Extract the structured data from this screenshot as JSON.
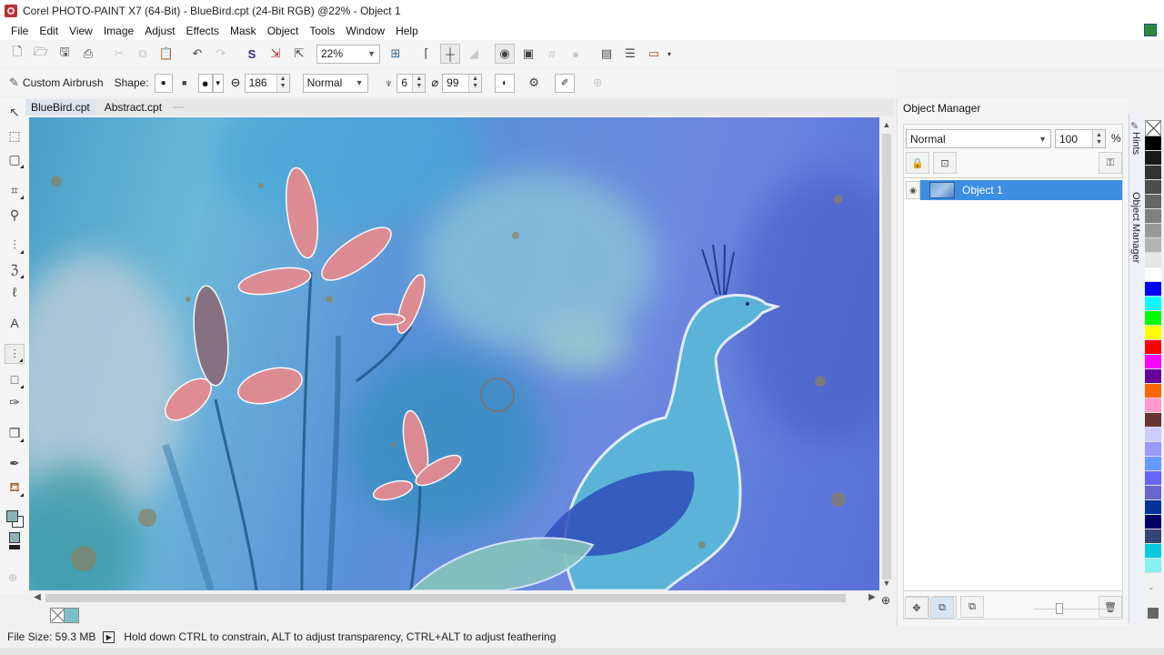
{
  "window": {
    "title": "Corel PHOTO-PAINT X7 (64-Bit) - BlueBird.cpt (24-Bit RGB) @22% - Object 1"
  },
  "menu": [
    {
      "label": "File"
    },
    {
      "label": "Edit"
    },
    {
      "label": "View"
    },
    {
      "label": "Image"
    },
    {
      "label": "Adjust"
    },
    {
      "label": "Effects"
    },
    {
      "label": "Mask"
    },
    {
      "label": "Object"
    },
    {
      "label": "Tools"
    },
    {
      "label": "Window"
    },
    {
      "label": "Help"
    }
  ],
  "toolbar": {
    "icons": [
      "new-icon",
      "open-icon",
      "save-icon",
      "print-icon",
      "cut-icon",
      "copy-icon",
      "paste-icon",
      "undo-icon",
      "redo-icon",
      "corel-connect-icon",
      "import-icon",
      "export-icon"
    ],
    "zoom_value": "22%",
    "icons_right": [
      "full-screen-preview-icon",
      "rulers-icon",
      "guidelines-icon",
      "snap-icon",
      "show-mask-icon",
      "show-mask-marquee-icon",
      "grid-icon",
      "align-icon",
      "application-launcher-icon",
      "options-icon",
      "welcome-screen-icon"
    ]
  },
  "propbar": {
    "tool_name": "Custom Airbrush",
    "shape_label": "Shape:",
    "nib_size": "186",
    "merge_mode": "Normal",
    "transparency": "6",
    "soft_edge": "99"
  },
  "toolbox": [
    "pick-tool-icon",
    "mask-transform-tool-icon",
    "rectangle-mask-tool-icon",
    "crop-tool-icon",
    "zoom-tool-icon",
    "clone-tool-icon",
    "smear-tool-icon",
    "liquid-smear-tool-icon",
    "text-tool-icon",
    "paint-tool-icon",
    "rectangle-tool-icon",
    "effect-tool-icon",
    "drop-shadow-tool-icon",
    "eyedropper-tool-icon",
    "fill-tool-icon"
  ],
  "doc_tabs": [
    {
      "label": "BlueBird.cpt",
      "active": true
    },
    {
      "label": "Abstract.cpt",
      "active": false
    }
  ],
  "docker": {
    "title": "Object Manager",
    "merge_mode": "Normal",
    "opacity": "100",
    "percent": "%",
    "objects": [
      {
        "name": "Object 1",
        "selected": true
      }
    ]
  },
  "side_tabs": [
    "Hints",
    "Object Manager"
  ],
  "palette": [
    "#000000",
    "#1a1a1a",
    "#333333",
    "#4d4d4d",
    "#666666",
    "#808080",
    "#999999",
    "#b3b3b3",
    "#e6e6e6",
    "#ffffff",
    "#0000ff",
    "#00ffff",
    "#00ff00",
    "#ffff00",
    "#ff0000",
    "#ff00ff",
    "#660099",
    "#ff6600",
    "#ff99cc",
    "#663333",
    "#ccccff",
    "#9999ff",
    "#6699ff",
    "#6666ff",
    "#6666cc",
    "#003399",
    "#000066",
    "#334477",
    "#00ccdd",
    "#88f0f0"
  ],
  "status": {
    "file_size": "File Size: 59.3 MB",
    "hint": "Hold down CTRL to constrain, ALT to adjust transparency, CTRL+ALT to adjust feathering"
  }
}
